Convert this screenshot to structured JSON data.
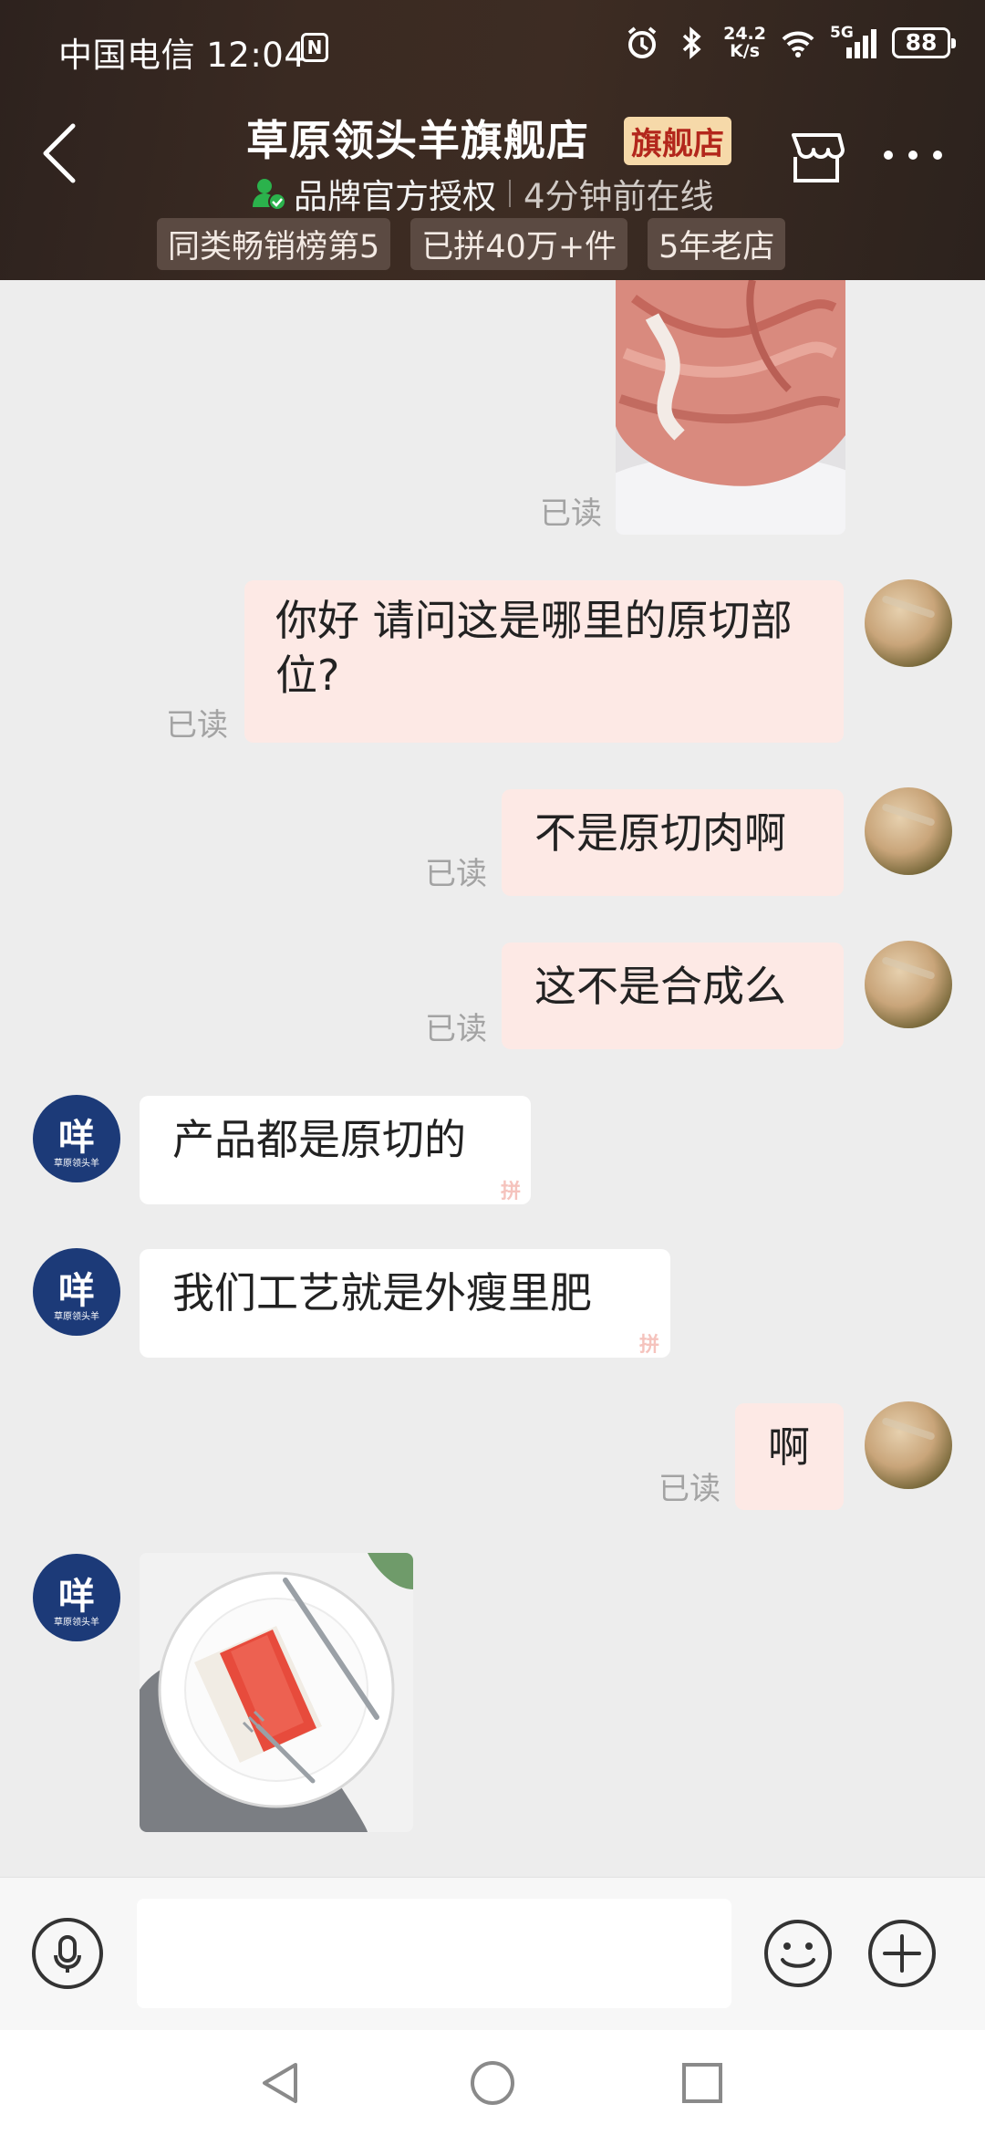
{
  "status_bar": {
    "carrier_time": "中国电信 12:04",
    "nfc_label": "N",
    "speed_value": "24.2",
    "speed_unit": "K/s",
    "network": "5G",
    "battery": "88"
  },
  "header": {
    "shop_name": "草原领头羊旗舰店",
    "flag_badge": "旗舰店",
    "authorization": "品牌官方授权",
    "online_status": "4分钟前在线",
    "tags": [
      "同类畅销榜第5",
      "已拼40万+件",
      "5年老店"
    ]
  },
  "chat": {
    "read_label": "已读",
    "pin_mark": "拼",
    "shop_avatar_glyph": "咩",
    "shop_avatar_caption": "草原领头羊",
    "messages": [
      {
        "from": "me",
        "type": "image",
        "content": "meat-photo"
      },
      {
        "from": "me",
        "type": "text",
        "text": "你好  请问这是哪里的原切部位?"
      },
      {
        "from": "me",
        "type": "text",
        "text": "不是原切肉啊"
      },
      {
        "from": "me",
        "type": "text",
        "text": "这不是合成么"
      },
      {
        "from": "shop",
        "type": "text",
        "text": "产品都是原切的"
      },
      {
        "from": "shop",
        "type": "text",
        "text": "我们工艺就是外瘦里肥"
      },
      {
        "from": "me",
        "type": "text",
        "text": "啊"
      },
      {
        "from": "shop",
        "type": "image",
        "content": "steak-on-plate-photo"
      }
    ]
  },
  "input_bar": {
    "placeholder": "",
    "value": ""
  },
  "colors": {
    "header_bg": "#3a2a22",
    "my_bubble": "#fde9e5",
    "their_bubble": "#ffffff",
    "chat_bg": "#ededed",
    "flag_badge_bg": "#f6d9a9",
    "flag_badge_text": "#b3271c",
    "auth_icon": "#2bb24c"
  }
}
